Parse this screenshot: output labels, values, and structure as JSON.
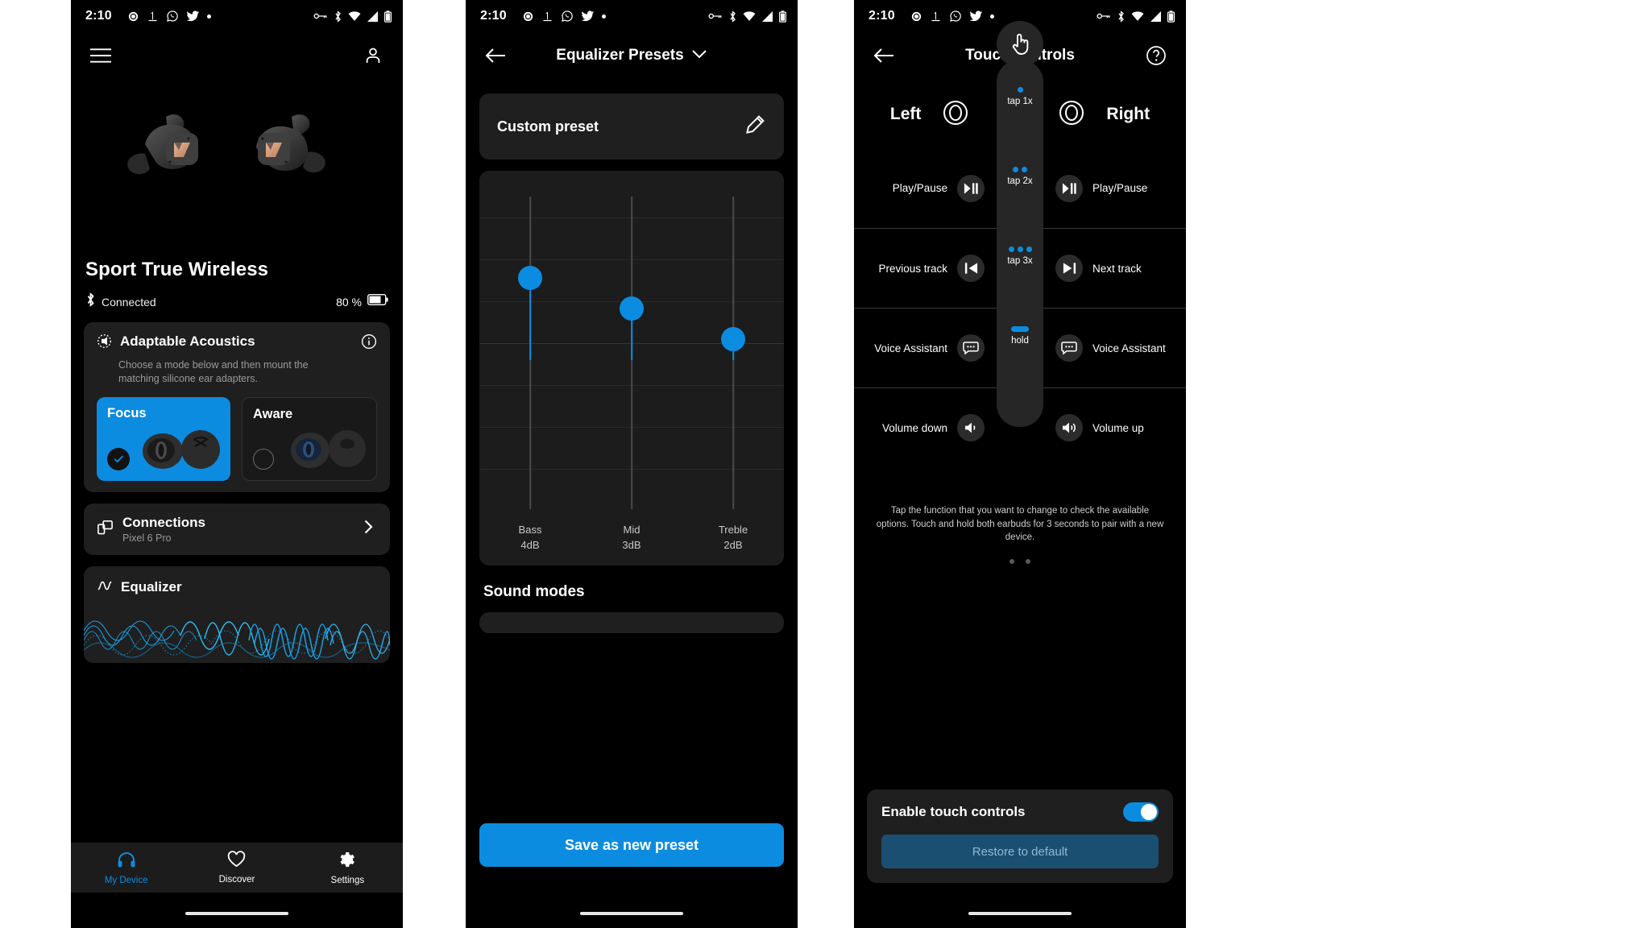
{
  "status_bar": {
    "time": "2:10",
    "left_icons": [
      "signal-app-icon",
      "onemore-app-icon",
      "whatsapp-icon",
      "twitter-icon",
      "more-dot-icon"
    ],
    "right_icons": [
      "vpn-key-icon",
      "bluetooth-icon",
      "wifi-icon",
      "cellular-icon",
      "battery-icon"
    ]
  },
  "colors": {
    "accent": "#0c8ce0",
    "card": "#1f1f1f",
    "background": "#000000",
    "muted": "#9a9a9a"
  },
  "phone1": {
    "menu_icon": "hamburger-menu-icon",
    "account_icon": "account-person-icon",
    "device_name": "Sport True Wireless",
    "connection_status": "Connected",
    "battery_percent": "80 %",
    "adaptable": {
      "title": "Adaptable Acoustics",
      "subtitle": "Choose a mode below and then mount the matching silicone ear adapters.",
      "info_icon": "info-circle-icon",
      "modes": [
        {
          "label": "Focus",
          "selected": true
        },
        {
          "label": "Aware",
          "selected": false
        }
      ]
    },
    "connections": {
      "title": "Connections",
      "subtitle": "Pixel 6 Pro",
      "icon": "devices-icon"
    },
    "equalizer": {
      "title": "Equalizer",
      "icon": "equalizer-wave-icon"
    },
    "nav": [
      {
        "label": "My Device",
        "icon": "headphones-icon",
        "active": true
      },
      {
        "label": "Discover",
        "icon": "heart-icon",
        "active": false
      },
      {
        "label": "Settings",
        "icon": "gear-icon",
        "active": false
      }
    ]
  },
  "phone2": {
    "back_icon": "back-arrow-icon",
    "title": "Equalizer Presets",
    "title_chevron": "chevron-down-icon",
    "preset": {
      "name": "Custom preset",
      "edit_icon": "pencil-edit-icon"
    },
    "sound_modes_title": "Sound modes",
    "save_button": "Save as new preset",
    "chart_data": {
      "type": "bar",
      "title": "Custom preset",
      "categories": [
        "Bass",
        "Mid",
        "Treble"
      ],
      "values": [
        4,
        3,
        2
      ],
      "value_labels": [
        "4dB",
        "3dB",
        "2dB"
      ],
      "xlabel": "",
      "ylabel": "dB",
      "ylim": [
        -6,
        6
      ],
      "grid": true,
      "legend": "none"
    }
  },
  "phone3": {
    "back_icon": "back-arrow-icon",
    "title": "Touch controls",
    "help_icon": "help-circle-icon",
    "left_label": "Left",
    "right_label": "Right",
    "left_bud_icon": "left-earbud-icon",
    "right_bud_icon": "right-earbud-icon",
    "touch_hand_icon": "touch-hand-icon",
    "rows": [
      {
        "gesture": "tap 1x",
        "gesture_type": "dots-1",
        "left": "Play/Pause",
        "left_icon": "play-pause-icon",
        "right": "Play/Pause",
        "right_icon": "play-pause-icon"
      },
      {
        "gesture": "tap 2x",
        "gesture_type": "dots-2",
        "left": "Previous track",
        "left_icon": "previous-track-icon",
        "right": "Next track",
        "right_icon": "next-track-icon"
      },
      {
        "gesture": "tap 3x",
        "gesture_type": "dots-3",
        "left": "Voice Assistant",
        "left_icon": "voice-assistant-icon",
        "right": "Voice Assistant",
        "right_icon": "voice-assistant-icon"
      },
      {
        "gesture": "hold",
        "gesture_type": "bar",
        "left": "Volume down",
        "left_icon": "volume-down-icon",
        "right": "Volume up",
        "right_icon": "volume-up-icon"
      }
    ],
    "hint": "Tap the function that you want to change to check the available options. Touch and hold both earbuds for 3 seconds to pair with a new device.",
    "enable_label": "Enable touch controls",
    "enable_on": true,
    "restore_label": "Restore to default"
  }
}
